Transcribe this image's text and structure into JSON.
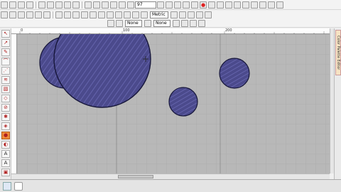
{
  "toolbar": {
    "zoom_value": "97",
    "units_label": "Metric",
    "fill_none_label": "None",
    "outline_none_label": "None"
  },
  "rulers": {
    "top_labels": [
      "0",
      "100",
      "200"
    ]
  },
  "side_panel": {
    "tab_label": "Color Palette Editor"
  },
  "colors": {
    "fabric": "#b8b8b8",
    "grid": "#a9a9a9",
    "embroidery_fill": "#4b4a8c",
    "embroidery_stitch": "#6b6ab4",
    "embroidery_outline": "#16163a"
  },
  "shapes": [
    {
      "name": "large-circle",
      "label": ""
    },
    {
      "name": "small-left-bump",
      "label": ""
    },
    {
      "name": "medium-circle-right",
      "label": ""
    },
    {
      "name": "medium-circle-center",
      "label": ""
    }
  ]
}
